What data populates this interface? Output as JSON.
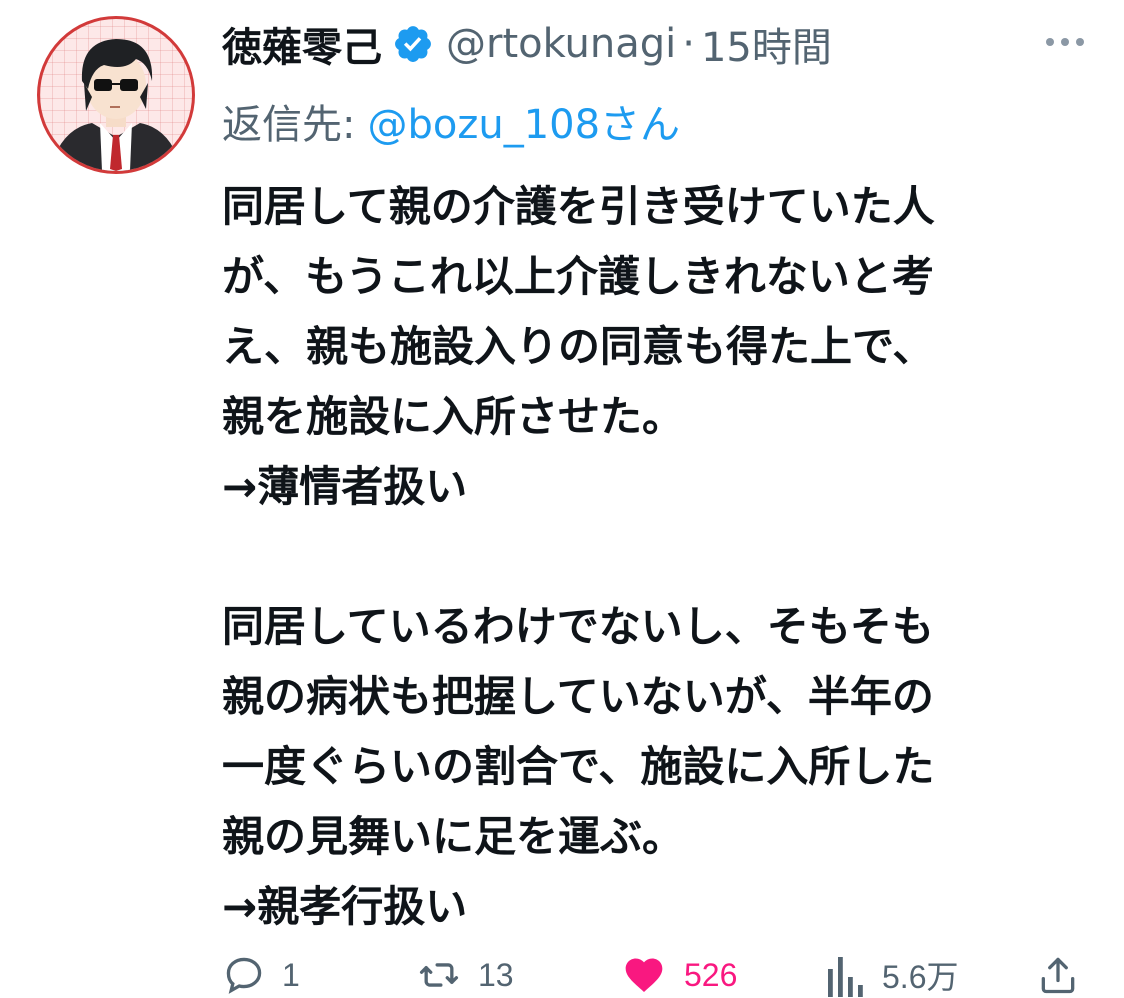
{
  "author": {
    "display_name": "徳薙零己",
    "handle": "@rtokunagi",
    "separator": "·",
    "time": "15時間",
    "verified_icon": "verified-badge-icon",
    "avatar_icon": "avatar-illustration"
  },
  "reply": {
    "prefix": "返信先:",
    "mention": "@bozu_108さん"
  },
  "body": {
    "lines": [
      "同居して親の介護を引き受けていた人",
      "が、もうこれ以上介護しきれないと考",
      "え、親も施設入りの同意も得た上で、",
      "親を施設に入所させた。",
      "→薄情者扱い",
      "",
      "同居しているわけでないし、そもそも",
      "親の病状も把握していないが、半年の",
      "一度ぐらいの割合で、施設に入所した",
      "親の見舞いに足を運ぶ。",
      "→親孝行扱い"
    ]
  },
  "actions": {
    "reply": {
      "icon": "reply-icon",
      "count": "1"
    },
    "retweet": {
      "icon": "retweet-icon",
      "count": "13"
    },
    "like": {
      "icon": "heart-icon",
      "count": "526",
      "color": "#f91880"
    },
    "views": {
      "icon": "views-icon",
      "count": "5.6万"
    },
    "share": {
      "icon": "share-icon"
    }
  },
  "colors": {
    "text": "#0f1419",
    "secondary": "#536471",
    "link": "#1d9bf0",
    "like": "#f91880",
    "avatar_border": "#d23a3a"
  }
}
